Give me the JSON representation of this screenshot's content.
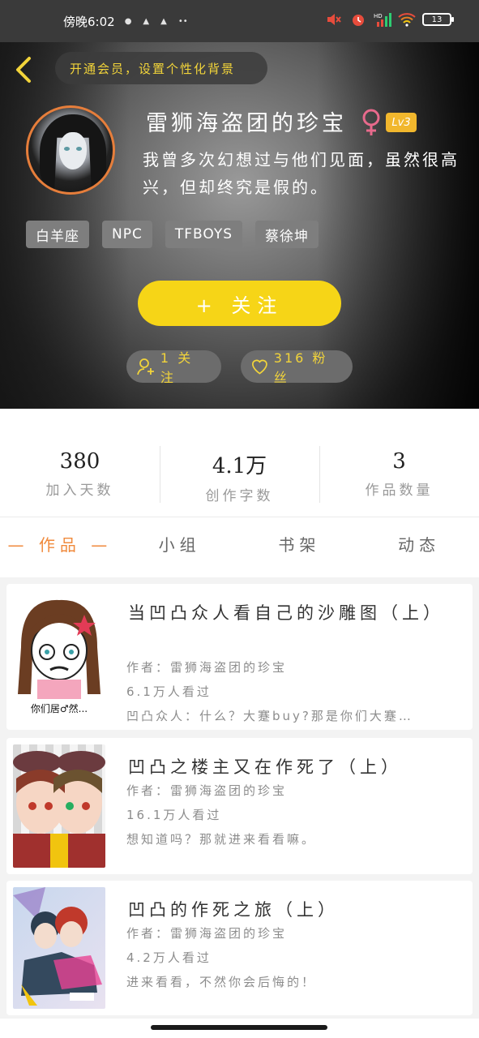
{
  "status_bar": {
    "time": "傍晚6:02",
    "battery": "13",
    "hd_label": "HD"
  },
  "header": {
    "vip_prompt": "开通会员，设置个性化背景",
    "username": "雷狮海盗团的珍宝",
    "level": "Lv3",
    "bio": "我曾多次幻想过与他们见面，虽然很高兴，但却终究是假的。",
    "tags": [
      "白羊座",
      "NPC",
      "TFBOYS",
      "蔡徐坤"
    ],
    "follow_button": "+ 关注",
    "following_label": "1 关注",
    "fans_label": "316 粉丝"
  },
  "stats": [
    {
      "value": "380",
      "label": "加入天数"
    },
    {
      "value": "4.1万",
      "label": "创作字数"
    },
    {
      "value": "3",
      "label": "作品数量"
    }
  ],
  "tabs": [
    {
      "label": "— 作品 —",
      "active": true
    },
    {
      "label": "小组",
      "active": false
    },
    {
      "label": "书架",
      "active": false
    },
    {
      "label": "动态",
      "active": false
    }
  ],
  "works": [
    {
      "title": "当凹凸众人看自己的沙雕图（上）",
      "author": "作者：雷狮海盗团的珍宝",
      "views": "6.1万人看过",
      "summary": "凹凸众人：什么？大蹇buy?那是你们大蹇…",
      "thumb_caption": "你们居♂然..."
    },
    {
      "title": "凹凸之楼主又在作死了（上）",
      "author": "作者：雷狮海盗团的珍宝",
      "views": "16.1万人看过",
      "summary": "想知道吗？那就进来看看嘛。"
    },
    {
      "title": "凹凸的作死之旅（上）",
      "author": "作者：雷狮海盗团的珍宝",
      "views": "4.2万人看过",
      "summary": "进来看看，不然你会后悔的！"
    }
  ],
  "colors": {
    "accent_yellow": "#f6d517",
    "accent_orange": "#f08a3c",
    "pill_text": "#f2d43a",
    "female_pink": "#e86a8c"
  }
}
